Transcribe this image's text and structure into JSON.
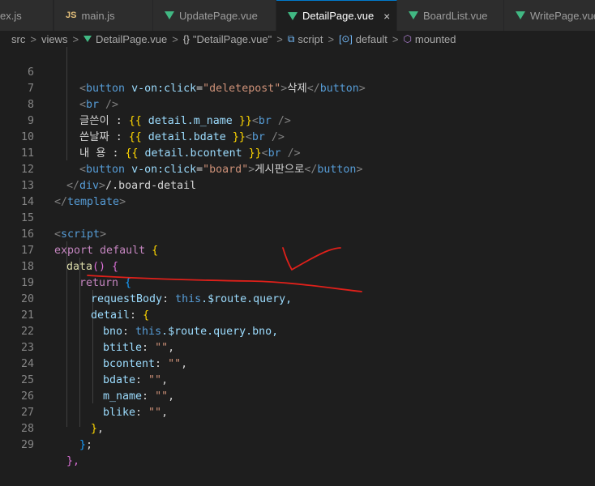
{
  "tabs": [
    {
      "label": "ex.js",
      "icon": "js-icon",
      "active": false
    },
    {
      "label": "main.js",
      "icon": "js-icon",
      "active": false
    },
    {
      "label": "UpdatePage.vue",
      "icon": "vue-icon",
      "active": false
    },
    {
      "label": "DetailPage.vue",
      "icon": "vue-icon",
      "active": true
    },
    {
      "label": "BoardList.vue",
      "icon": "vue-icon",
      "active": false
    },
    {
      "label": "WritePage.vue",
      "icon": "vue-icon",
      "active": false
    }
  ],
  "tab_js_badge": "JS",
  "close_glyph": "×",
  "breadcrumb": {
    "items": [
      "src",
      "views",
      "DetailPage.vue",
      "\"DetailPage.vue\"",
      "script",
      "default",
      "mounted"
    ],
    "sep": ">",
    "sym_braces": "{}",
    "sym_tag": "⧉",
    "sym_field": "[⊙]",
    "sym_cube": "⬡"
  },
  "lines": [
    {
      "n": "6"
    },
    {
      "n": "7"
    },
    {
      "n": "8"
    },
    {
      "n": "9"
    },
    {
      "n": "10"
    },
    {
      "n": "11"
    },
    {
      "n": "12"
    },
    {
      "n": "13"
    },
    {
      "n": "14"
    },
    {
      "n": "15"
    },
    {
      "n": "16"
    },
    {
      "n": "17"
    },
    {
      "n": "18"
    },
    {
      "n": "19"
    },
    {
      "n": "20"
    },
    {
      "n": "21"
    },
    {
      "n": "22"
    },
    {
      "n": "23"
    },
    {
      "n": "24"
    },
    {
      "n": "25"
    },
    {
      "n": "26"
    },
    {
      "n": "27"
    },
    {
      "n": "28"
    },
    {
      "n": "29"
    }
  ],
  "code": {
    "l6": {
      "lt": "<",
      "tag": "button",
      "attr": "v-on:click",
      "eq": "=",
      "val": "\"deletepost\"",
      "gt": ">",
      "text": "삭제",
      "close": "</",
      "ctag": "button",
      "cgt": ">"
    },
    "l7": {
      "lt": "<",
      "tag": "br",
      "end": " />"
    },
    "l8": {
      "label": "글쓴이 : ",
      "ob": "{{",
      "expr": " detail.m_name ",
      "cb": "}}",
      "lt": "<",
      "tag": "br",
      "end": " />"
    },
    "l9": {
      "label": "쓴날짜 : ",
      "ob": "{{",
      "expr": " detail.bdate ",
      "cb": "}}",
      "lt": "<",
      "tag": "br",
      "end": " />"
    },
    "l10": {
      "label": "내 용 : ",
      "ob": "{{",
      "expr": " detail.bcontent ",
      "cb": "}}",
      "lt": "<",
      "tag": "br",
      "end": " />"
    },
    "l11": {
      "lt": "<",
      "tag": "button",
      "attr": "v-on:click",
      "eq": "=",
      "val": "\"board\"",
      "gt": ">",
      "text": "게시판으로",
      "close": "</",
      "ctag": "button",
      "cgt": ">"
    },
    "l12": {
      "close": "</",
      "tag": "div",
      "gt": ">",
      "comment": "/.board-detail"
    },
    "l13": {
      "close": "</",
      "tag": "template",
      "gt": ">"
    },
    "l15": {
      "lt": "<",
      "tag": "script",
      "gt": ">"
    },
    "l16": {
      "kw": "export",
      "def": " default",
      "brace": " {"
    },
    "l17": {
      "fn": "data",
      "paren": "()",
      "brace": " {"
    },
    "l18": {
      "kw": "return",
      "brace": " {"
    },
    "l19": {
      "prop": "requestBody",
      "colon": ": ",
      "this": "this",
      "rest": ".$route.query,"
    },
    "l20": {
      "prop": "detail",
      "colon": ": ",
      "brace": "{"
    },
    "l21": {
      "prop": "bno",
      "colon": ": ",
      "this": "this",
      "rest": ".$route.query.bno,"
    },
    "l22": {
      "prop": "btitle",
      "colon": ": ",
      "str": "\"\"",
      "comma": ","
    },
    "l23": {
      "prop": "bcontent",
      "colon": ": ",
      "str": "\"\"",
      "comma": ","
    },
    "l24": {
      "prop": "bdate",
      "colon": ": ",
      "str": "\"\"",
      "comma": ","
    },
    "l25": {
      "prop": "m_name",
      "colon": ": ",
      "str": "\"\"",
      "comma": ","
    },
    "l26": {
      "prop": "blike",
      "colon": ": ",
      "str": "\"\"",
      "comma": ","
    },
    "l27": {
      "brace": "}",
      "comma": ","
    },
    "l28": {
      "brace": "}",
      "semi": ";"
    },
    "l29": {
      "brace": "},"
    }
  },
  "colors": {
    "editor_bg": "#1e1e1e",
    "tabbar_bg": "#252526",
    "accent": "#007acc",
    "annotation": "#e0201a",
    "vue_green": "#41b883"
  }
}
